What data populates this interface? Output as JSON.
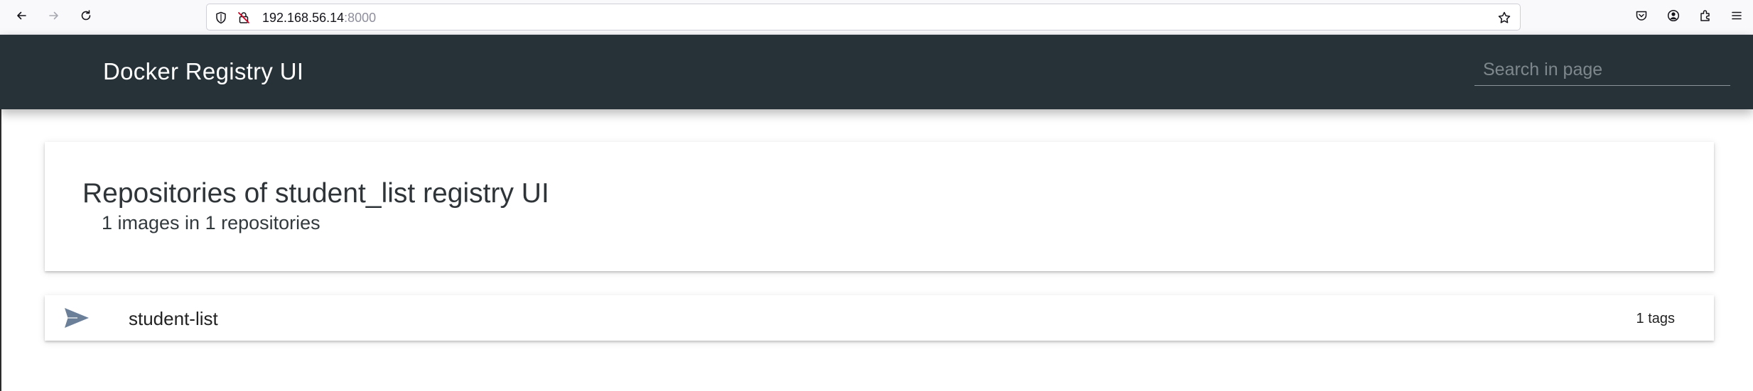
{
  "browser": {
    "url_host": "192.168.56.14",
    "url_port": ":8000",
    "icons": {
      "back": "back-arrow-icon",
      "forward": "forward-arrow-icon",
      "reload": "reload-icon",
      "shield": "tracking-shield-icon",
      "insecure": "insecure-lock-icon",
      "bookmark": "star-icon",
      "pocket": "pocket-icon",
      "account": "account-icon",
      "extensions": "extensions-icon",
      "menu": "hamburger-menu-icon"
    }
  },
  "header": {
    "title": "Docker Registry UI",
    "search_placeholder": "Search in page",
    "background": "#263238"
  },
  "main": {
    "title": "Repositories of student_list registry UI",
    "subtitle": "1 images in 1 repositories"
  },
  "repositories": [
    {
      "name": "student-list",
      "tags": "1 tags",
      "icon": "send-icon",
      "icon_color": "#6b7f99"
    }
  ]
}
